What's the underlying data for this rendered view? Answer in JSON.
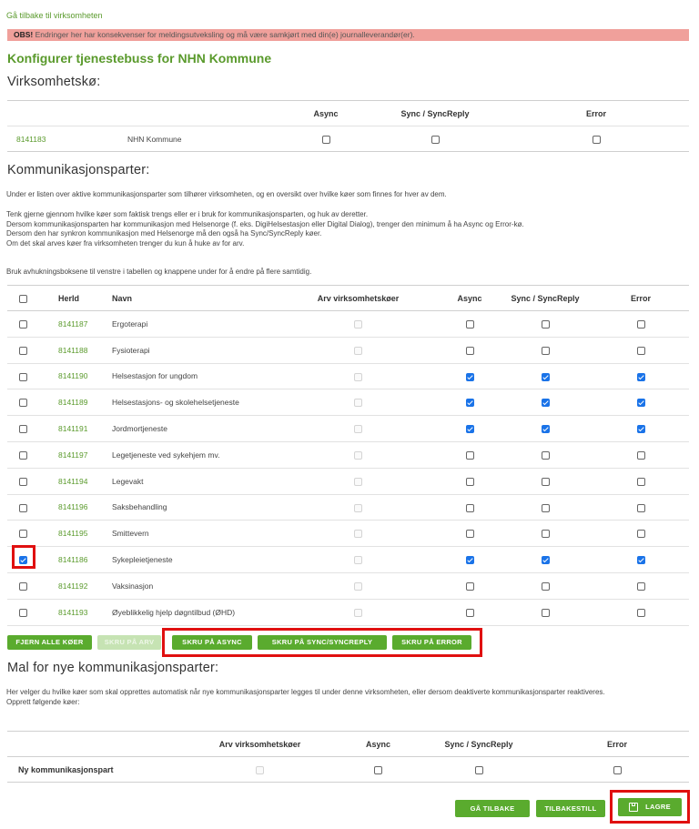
{
  "back_link": "Gå tilbake til virksomheten",
  "warning": {
    "prefix": "OBS!",
    "text": " Endringer her har konsekvenser for meldingsutveksling og må være samkjørt med din(e) journalleverandør(er)."
  },
  "page_title": "Konfigurer tjenestebuss for NHN Kommune",
  "section_org": {
    "heading": "Virksomhetskø:",
    "columns": [
      "Async",
      "Sync / SyncReply",
      "Error"
    ],
    "row": {
      "herid": "8141183",
      "name": "NHN Kommune",
      "async": false,
      "sync": false,
      "error": false
    }
  },
  "section_parties": {
    "heading": "Kommunikasjonsparter:",
    "intro": "Under er listen over aktive kommunikasjonsparter som tilhører virksomheten, og en oversikt over hvilke køer som finnes for hver av dem.",
    "guidance": [
      "Tenk gjerne gjennom hvilke køer som faktisk trengs eller er i bruk for kommunikasjonsparten, og huk av deretter.",
      "Dersom kommunikasjonsparten har kommunikasjon med Helsenorge (f. eks. DigiHelsestasjon eller Digital Dialog), trenger den minimum å ha Async og Error-kø.",
      "Dersom den har synkron kommunikasjon med Helsenorge må den også ha Sync/SyncReply køer.",
      "Om det skal arves køer fra virksomheten trenger du kun å huke av for arv."
    ],
    "bulk_hint": "Bruk avhukningsboksene til venstre i tabellen og knappene under for å endre på flere samtidig.",
    "columns": {
      "herid": "HerId",
      "name": "Navn",
      "inherit": "Arv virksomhetskøer",
      "async": "Async",
      "sync": "Sync / SyncReply",
      "error": "Error"
    },
    "rows": [
      {
        "selected": false,
        "herid": "8141187",
        "name": "Ergoterapi",
        "async": false,
        "sync": false,
        "error": false
      },
      {
        "selected": false,
        "herid": "8141188",
        "name": "Fysioterapi",
        "async": false,
        "sync": false,
        "error": false
      },
      {
        "selected": false,
        "herid": "8141190",
        "name": "Helsestasjon for ungdom",
        "async": true,
        "sync": true,
        "error": true
      },
      {
        "selected": false,
        "herid": "8141189",
        "name": "Helsestasjons- og skolehelsetjeneste",
        "async": true,
        "sync": true,
        "error": true
      },
      {
        "selected": false,
        "herid": "8141191",
        "name": "Jordmortjeneste",
        "async": true,
        "sync": true,
        "error": true
      },
      {
        "selected": false,
        "herid": "8141197",
        "name": "Legetjeneste ved sykehjem mv.",
        "async": false,
        "sync": false,
        "error": false
      },
      {
        "selected": false,
        "herid": "8141194",
        "name": "Legevakt",
        "async": false,
        "sync": false,
        "error": false
      },
      {
        "selected": false,
        "herid": "8141196",
        "name": "Saksbehandling",
        "async": false,
        "sync": false,
        "error": false
      },
      {
        "selected": false,
        "herid": "8141195",
        "name": "Smittevern",
        "async": false,
        "sync": false,
        "error": false
      },
      {
        "selected": true,
        "herid": "8141186",
        "name": "Sykepleietjeneste",
        "async": true,
        "sync": true,
        "error": true
      },
      {
        "selected": false,
        "herid": "8141192",
        "name": "Vaksinasjon",
        "async": false,
        "sync": false,
        "error": false
      },
      {
        "selected": false,
        "herid": "8141193",
        "name": "Øyeblikkelig hjelp døgntilbud (ØHD)",
        "async": false,
        "sync": false,
        "error": false
      }
    ],
    "buttons": {
      "remove_all": "FJERN ALLE KØER",
      "inherit": "SKRU PÅ ARV",
      "async": "SKRU PÅ ASYNC",
      "sync": "SKRU PÅ SYNC/SYNCREPLY",
      "error": "SKRU PÅ ERROR"
    }
  },
  "section_template": {
    "heading": "Mal for nye kommunikasjonsparter:",
    "description": "Her velger du hvilke køer som skal opprettes automatisk når nye kommunikasjonsparter legges til under denne virksomheten, eller dersom deaktiverte kommunikasjonsparter reaktiveres.",
    "create_label": "Opprett følgende køer:",
    "columns": [
      "Arv virksomhetskøer",
      "Async",
      "Sync / SyncReply",
      "Error"
    ],
    "row_label": "Ny kommunikasjonspart"
  },
  "footer": {
    "back": "GÅ TILBAKE",
    "reset": "TILBAKESTILL",
    "save": "LAGRE"
  },
  "colors": {
    "accent": "#5aab2e",
    "link": "#5a9a2c",
    "warning_bg": "#f0a09b",
    "checkbox": "#1a73e8",
    "highlight": "#e01010"
  }
}
